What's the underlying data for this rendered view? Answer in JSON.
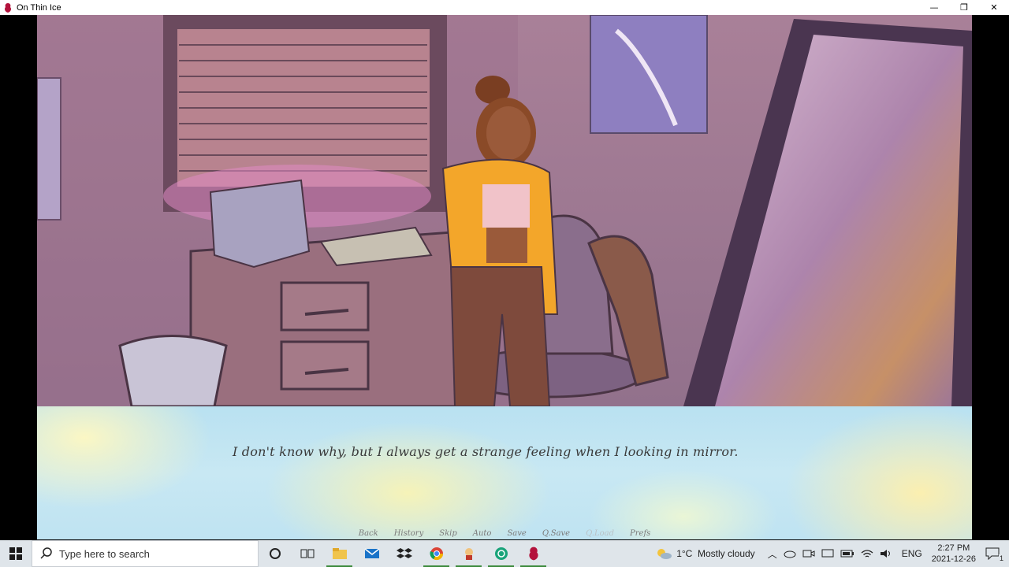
{
  "window": {
    "title": "On Thin Ice",
    "minimize": "—",
    "restore": "❐",
    "close": "✕"
  },
  "dialogue": {
    "text": "I don't know why, but I always get a strange feeling when I looking in mirror."
  },
  "quick_menu": [
    {
      "label": "Back",
      "enabled": true
    },
    {
      "label": "History",
      "enabled": true
    },
    {
      "label": "Skip",
      "enabled": true
    },
    {
      "label": "Auto",
      "enabled": true
    },
    {
      "label": "Save",
      "enabled": true
    },
    {
      "label": "Q.Save",
      "enabled": true
    },
    {
      "label": "Q.Load",
      "enabled": false
    },
    {
      "label": "Prefs",
      "enabled": true
    }
  ],
  "taskbar": {
    "search_placeholder": "Type here to search",
    "weather": "1°C  Mostly cloudy",
    "language": "ENG",
    "time": "2:27 PM",
    "date": "2021-12-26",
    "notification_count": "1",
    "apps": [
      "task-view-icon",
      "file-explorer-icon",
      "mail-icon",
      "dropbox-icon",
      "chrome-icon",
      "game-app-icon",
      "openai-icon",
      "on-thin-ice-icon"
    ]
  },
  "colors": {
    "taskbar_bg": "#dfe5ea",
    "dialogue_text": "#3a3a3a",
    "active_indicator": "#3c8a3c"
  }
}
